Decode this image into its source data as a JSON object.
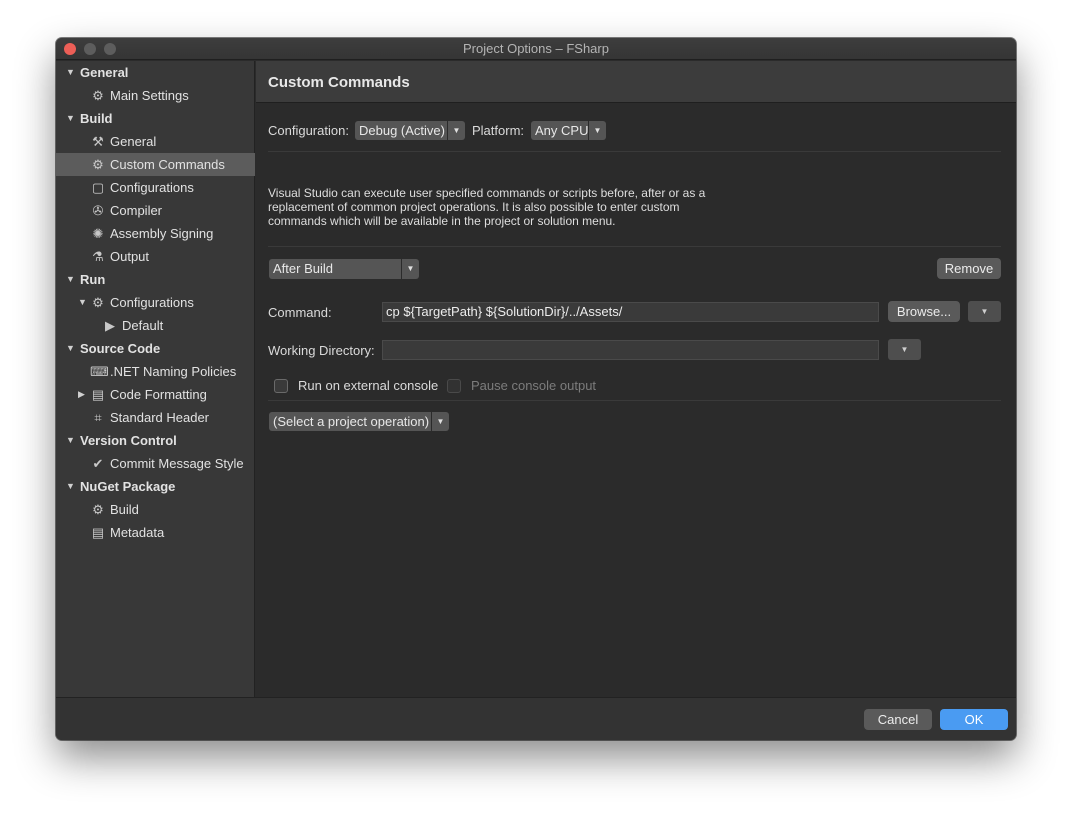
{
  "window": {
    "title": "Project Options – FSharp"
  },
  "sidebar": {
    "items": [
      {
        "label": "General",
        "kind": "category",
        "expanded": true
      },
      {
        "label": "Main Settings",
        "icon": "gear-icon"
      },
      {
        "label": "Build",
        "kind": "category",
        "expanded": true
      },
      {
        "label": "General",
        "icon": "hammer-icon"
      },
      {
        "label": "Custom Commands",
        "icon": "gear-icon",
        "selected": true
      },
      {
        "label": "Configurations",
        "icon": "window-icon"
      },
      {
        "label": "Compiler",
        "icon": "compiler-icon"
      },
      {
        "label": "Assembly Signing",
        "icon": "seal-icon"
      },
      {
        "label": "Output",
        "icon": "flask-icon"
      },
      {
        "label": "Run",
        "kind": "category",
        "expanded": true
      },
      {
        "label": "Configurations",
        "icon": "gear-icon",
        "expanded": true
      },
      {
        "label": "Default",
        "icon": "play-icon"
      },
      {
        "label": "Source Code",
        "kind": "category",
        "expanded": true
      },
      {
        "label": ".NET Naming Policies",
        "icon": "keyboard-icon"
      },
      {
        "label": "Code Formatting",
        "icon": "code-format-icon",
        "expanded": false
      },
      {
        "label": "Standard Header",
        "icon": "hash-icon"
      },
      {
        "label": "Version Control",
        "kind": "category",
        "expanded": true
      },
      {
        "label": "Commit Message Style",
        "icon": "check-circle-icon"
      },
      {
        "label": "NuGet Package",
        "kind": "category",
        "expanded": true
      },
      {
        "label": "Build",
        "icon": "gear-icon"
      },
      {
        "label": "Metadata",
        "icon": "document-icon"
      }
    ]
  },
  "main": {
    "title": "Custom Commands",
    "configuration_label": "Configuration:",
    "configuration_value": "Debug (Active)",
    "platform_label": "Platform:",
    "platform_value": "Any CPU",
    "description": "Visual Studio can execute user specified commands or scripts before, after or as a replacement of common project operations. It is also possible to enter custom commands which will be available in the project or solution menu.",
    "operation_value": "After Build",
    "remove_label": "Remove",
    "command_label": "Command:",
    "command_value": "cp ${TargetPath} ${SolutionDir}/../Assets/",
    "browse_label": "Browse...",
    "working_dir_label": "Working Directory:",
    "working_dir_value": "",
    "external_console_label": "Run on external console",
    "pause_console_label": "Pause console output",
    "select_operation_value": "(Select a project operation)"
  },
  "footer": {
    "cancel_label": "Cancel",
    "ok_label": "OK"
  },
  "colors": {
    "accent": "#4a9bf2",
    "close_button": "#ed5f57",
    "selection": "#5c5c5c"
  }
}
